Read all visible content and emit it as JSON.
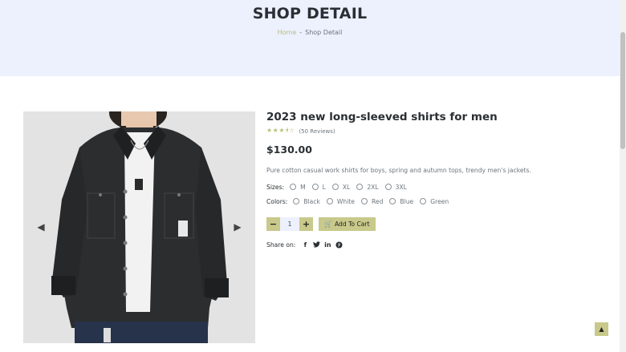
{
  "banner": {
    "title": "SHOP DETAIL",
    "breadcrumb": {
      "home": "Home",
      "separator": "-",
      "current": "Shop Detail"
    }
  },
  "product": {
    "title": "2023 new long-sleeved shirts for men",
    "rating": {
      "stars": 3.5,
      "max": 5,
      "reviews_text": "(50 Reviews)"
    },
    "price": "$130.00",
    "description": "Pure cotton casual work shirts for boys, spring and autumn tops, trendy men's jackets.",
    "sizes_label": "Sizes:",
    "sizes": [
      "M",
      "L",
      "XL",
      "2XL",
      "3XL"
    ],
    "colors_label": "Colors:",
    "colors": [
      "Black",
      "White",
      "Red",
      "Blue",
      "Green"
    ],
    "quantity": "1",
    "add_to_cart": "Add To Cart",
    "share_label": "Share on:"
  },
  "icons": {
    "prev": "chevron-left-icon",
    "next": "chevron-right-icon",
    "cart": "cart-icon",
    "minus": "minus-icon",
    "plus": "plus-icon",
    "share": [
      "facebook-icon",
      "twitter-icon",
      "linkedin-icon",
      "pinterest-icon"
    ],
    "back_to_top": "double-chevron-up-icon"
  },
  "colors_theme": {
    "accent": "#c8c98a",
    "banner_bg": "#edf0fd",
    "star": "#b9c07a"
  }
}
